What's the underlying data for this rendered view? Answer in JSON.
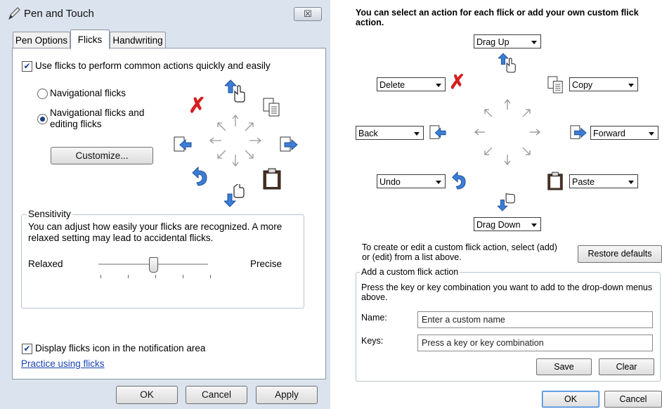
{
  "left_dialog": {
    "title": "Pen and Touch",
    "close_label": "☒",
    "tabs": [
      "Pen Options",
      "Flicks",
      "Handwriting"
    ],
    "use_flicks_label": "Use flicks to perform common actions quickly and easily",
    "use_flicks_checked": true,
    "radio_navigational": "Navigational flicks",
    "radio_editing_line1": "Navigational flicks and",
    "radio_editing_line2": "editing flicks",
    "selected_radio": "editing",
    "customize_label": "Customize...",
    "sensitivity": {
      "legend": "Sensitivity",
      "desc_line1": "You can adjust how easily your flicks are recognized. A more",
      "desc_line2": "relaxed setting may lead to accidental flicks.",
      "relaxed_label": "Relaxed",
      "precise_label": "Precise",
      "slider_level": 0.5
    },
    "display_icon_label": "Display flicks icon in the notification area",
    "display_icon_checked": true,
    "practice_link": "Practice using flicks",
    "ok_label": "OK",
    "cancel_label": "Cancel",
    "apply_label": "Apply"
  },
  "right_dialog": {
    "header_line1": "You can select an action for each flick or add your own custom flick",
    "header_line2": "action.",
    "dropdowns": {
      "up": "Drag Up",
      "up_right": "Copy",
      "up_left": "Delete",
      "left": "Back",
      "right": "Forward",
      "down_left": "Undo",
      "down_right": "Paste",
      "down": "Drag Down"
    },
    "custom_hint_line1": "To create or edit a custom flick action, select (add)",
    "custom_hint_line2": "or (edit) from a list above.",
    "restore_label": "Restore defaults",
    "add_custom": {
      "legend": "Add a custom flick action",
      "desc_line1": "Press the key or key combination you want to add to the drop-down menus",
      "desc_line2": "above.",
      "name_label": "Name:",
      "name_placeholder": "Enter a custom name",
      "keys_label": "Keys:",
      "keys_placeholder": "Press a key or key combination",
      "save_label": "Save",
      "clear_label": "Clear"
    },
    "ok_label": "OK",
    "cancel_label": "Cancel"
  },
  "icons": [
    "pen-icon",
    "drag-up-icon",
    "drag-down-icon",
    "delete-icon",
    "copy-icon",
    "back-icon",
    "forward-icon",
    "undo-icon",
    "paste-icon"
  ]
}
